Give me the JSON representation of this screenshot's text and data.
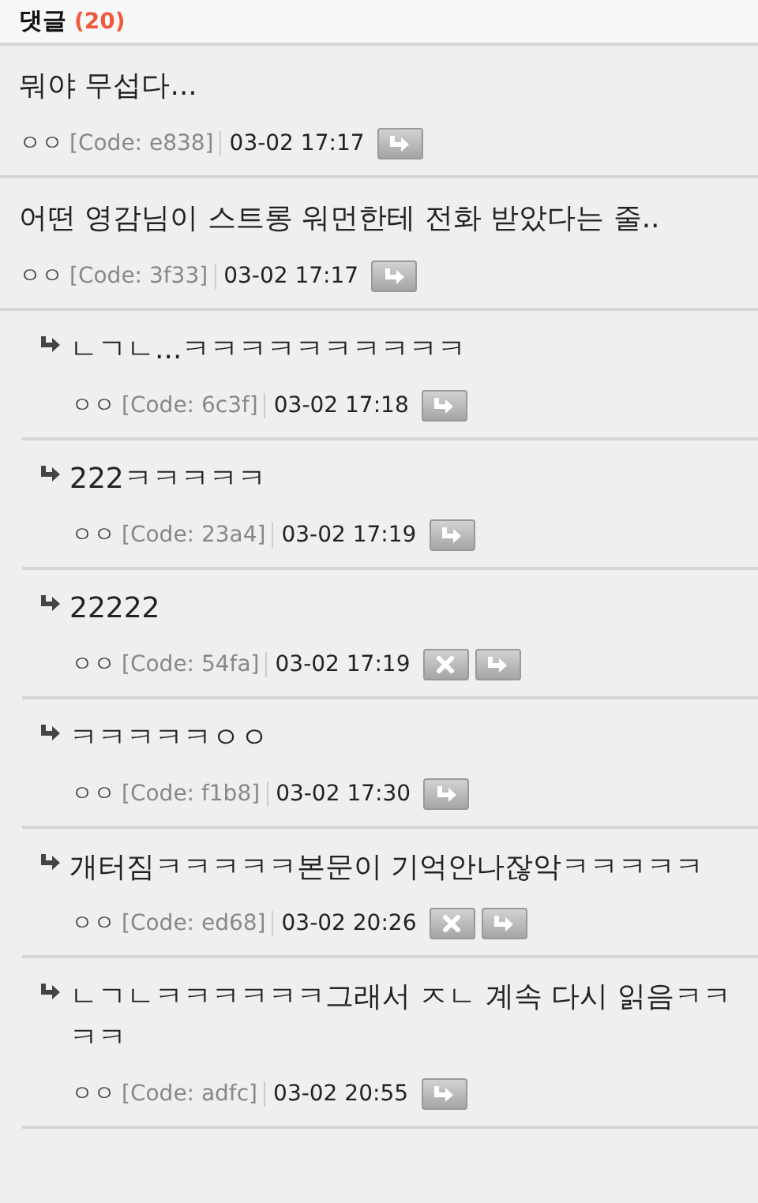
{
  "header": {
    "title": "댓글",
    "count": "(20)"
  },
  "comments": [
    {
      "kind": "top",
      "text": "뭐야 무섭다...",
      "author": "ㅇㅇ",
      "code": "[Code: e838]",
      "time": "03-02 17:17",
      "deletable": false
    },
    {
      "kind": "top",
      "text": "어떤 영감님이 스트롱 워먼한테 전화 받았다는 줄..",
      "author": "ㅇㅇ",
      "code": "[Code: 3f33]",
      "time": "03-02 17:17",
      "deletable": false
    },
    {
      "kind": "reply",
      "text": "ㄴㄱㄴ...ㅋㅋㅋㅋㅋㅋㅋㅋㅋㅋ",
      "author": "ㅇㅇ",
      "code": "[Code: 6c3f]",
      "time": "03-02 17:18",
      "deletable": false
    },
    {
      "kind": "reply",
      "text": "222ㅋㅋㅋㅋㅋ",
      "author": "ㅇㅇ",
      "code": "[Code: 23a4]",
      "time": "03-02 17:19",
      "deletable": false
    },
    {
      "kind": "reply",
      "text": "22222",
      "author": "ㅇㅇ",
      "code": "[Code: 54fa]",
      "time": "03-02 17:19",
      "deletable": true
    },
    {
      "kind": "reply",
      "text": "ㅋㅋㅋㅋㅋㅇㅇ",
      "author": "ㅇㅇ",
      "code": "[Code: f1b8]",
      "time": "03-02 17:30",
      "deletable": false
    },
    {
      "kind": "reply",
      "text": "개터짐ㅋㅋㅋㅋㅋ본문이 기억안나잖악ㅋㅋㅋㅋㅋ",
      "author": "ㅇㅇ",
      "code": "[Code: ed68]",
      "time": "03-02 20:26",
      "deletable": true
    },
    {
      "kind": "reply",
      "text": "ㄴㄱㄴㅋㅋㅋㅋㅋㅋ그래서 ㅈㄴ 계속 다시 읽음ㅋㅋㅋㅋ",
      "author": "ㅇㅇ",
      "code": "[Code: adfc]",
      "time": "03-02 20:55",
      "deletable": false
    }
  ]
}
